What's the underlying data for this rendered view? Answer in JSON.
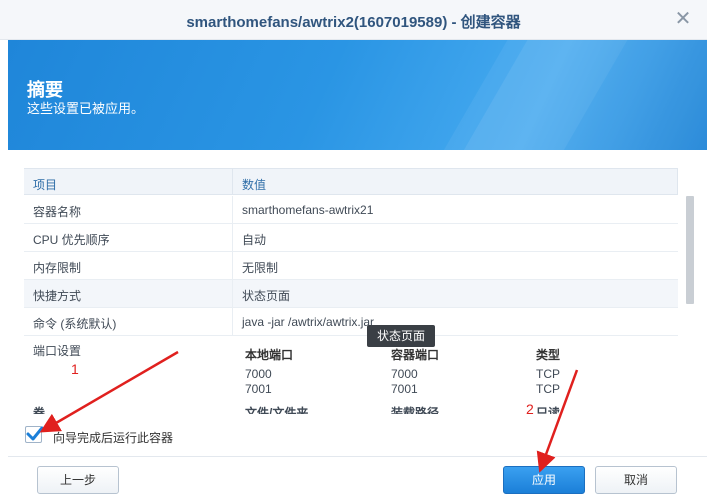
{
  "window": {
    "title": "smarthomefans/awtrix2(1607019589) - 创建容器",
    "close_glyph": "✕"
  },
  "banner": {
    "heading": "摘要",
    "subheading": "这些设置已被应用。"
  },
  "grid": {
    "col_item": "项目",
    "col_value": "数值",
    "rows": [
      {
        "key": "容器名称",
        "value": "smarthomefans-awtrix21"
      },
      {
        "key": "CPU 优先顺序",
        "value": "自动"
      },
      {
        "key": "内存限制",
        "value": "无限制"
      },
      {
        "key": "快捷方式",
        "value": "状态页面"
      },
      {
        "key": "命令 (系统默认)",
        "value": "java -jar /awtrix/awtrix.jar"
      }
    ],
    "ports": {
      "label": "端口设置",
      "headers": [
        "本地端口",
        "容器端口",
        "类型"
      ],
      "rows": [
        [
          "7000",
          "7000",
          "TCP"
        ],
        [
          "7001",
          "7001",
          "TCP"
        ]
      ]
    },
    "next_row_partial": {
      "key": "卷",
      "cols": [
        "文件/文件夹",
        "装载路径",
        "只读"
      ]
    }
  },
  "tooltip": "状态页面",
  "checkbox": {
    "label": "向导完成后运行此容器",
    "checked": true
  },
  "buttons": {
    "prev": "上一步",
    "apply": "应用",
    "cancel": "取消"
  },
  "annotations": {
    "marker_1": "1",
    "marker_2": "2"
  },
  "colors": {
    "accent": "#1f86d9",
    "annotation": "#e0201e"
  }
}
